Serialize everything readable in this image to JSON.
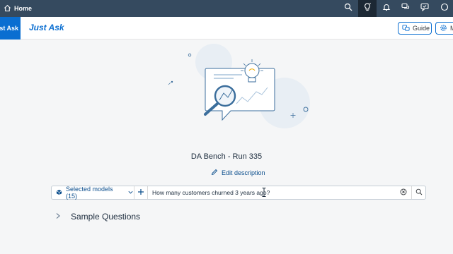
{
  "shell": {
    "home_label": "Home",
    "actions": [
      "search-icon",
      "lightbulb-icon",
      "bell-icon",
      "chat-icon",
      "feedback-icon",
      "help-icon"
    ]
  },
  "header": {
    "app_tab_label": "Just Ask",
    "title": "Just Ask",
    "guide_label": "Guide",
    "more_label": "M"
  },
  "main": {
    "run_title": "DA Bench - Run 335",
    "edit_description_label": "Edit description",
    "query": {
      "models_label": "Selected models (15)",
      "value": "How many customers churned 3 years ago?"
    },
    "sample_questions_label": "Sample Questions"
  },
  "colors": {
    "shell_bg": "#354a5f",
    "accent": "#0a6ed1",
    "link": "#0a4d8c"
  }
}
